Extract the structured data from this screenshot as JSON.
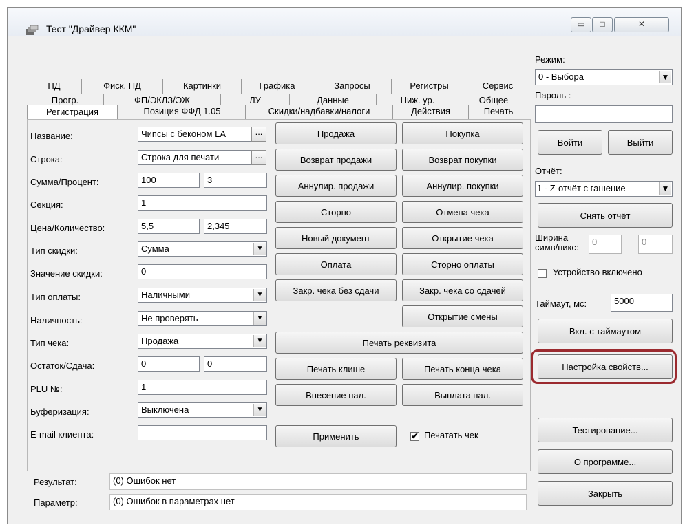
{
  "window": {
    "title": "Тест \"Драйвер ККМ\"",
    "min_label": "▭",
    "max_label": "□",
    "close_label": "✕"
  },
  "tabs": {
    "row1": [
      "ПД",
      "Фиск. ПД",
      "Картинки",
      "Графика",
      "Запросы",
      "Регистры",
      "Сервис"
    ],
    "row2": [
      "Прогр.",
      "ФП/ЭКЛЗ/ЭЖ",
      "ЛУ",
      "Данные",
      "Ниж. ур.",
      "Общее"
    ],
    "row3": [
      "Регистрация",
      "Позиция ФФД 1.05",
      "Скидки/надбавки/налоги",
      "Действия",
      "Печать"
    ],
    "active": "Регистрация"
  },
  "form": {
    "name_label": "Название:",
    "name_value": "Чипсы с беконом LA",
    "string_label": "Строка:",
    "string_value": "Строка для печати",
    "sum_label": "Сумма/Процент:",
    "sum_value": "100",
    "percent_value": "3",
    "section_label": "Секция:",
    "section_value": "1",
    "price_label": "Цена/Количество:",
    "price_value": "5,5",
    "qty_value": "2,345",
    "discount_type_label": "Тип скидки:",
    "discount_type_value": "Сумма",
    "discount_value_label": "Значение скидки:",
    "discount_value": "0",
    "payment_type_label": "Тип оплаты:",
    "payment_type_value": "Наличными",
    "cash_check_label": "Наличность:",
    "cash_check_value": "Не проверять",
    "receipt_type_label": "Тип чека:",
    "receipt_type_value": "Продажа",
    "remain_label": "Остаток/Сдача:",
    "remain_value": "0",
    "change_value": "0",
    "plu_label": "PLU №:",
    "plu_value": "1",
    "buffer_label": "Буферизация:",
    "buffer_value": "Выключена",
    "email_label": "E-mail клиента:",
    "email_value": "",
    "dots": "..."
  },
  "actions": {
    "sale": "Продажа",
    "purchase": "Покупка",
    "return_sale": "Возврат продажи",
    "return_purchase": "Возврат покупки",
    "cancel_sale": "Аннулир. продажи",
    "cancel_purchase": "Аннулир. покупки",
    "storno": "Сторно",
    "cancel_receipt": "Отмена чека",
    "new_document": "Новый документ",
    "open_receipt": "Открытие чека",
    "payment": "Оплата",
    "storno_payment": "Сторно оплаты",
    "close_no_change": "Закр. чека без сдачи",
    "close_with_change": "Закр. чека со сдачей",
    "open_shift": "Открытие смены",
    "print_requisite": "Печать реквизита",
    "print_cliche": "Печать клише",
    "print_end": "Печать конца чека",
    "cash_in": "Внесение нал.",
    "cash_out": "Выплата нал.",
    "apply": "Применить",
    "print_receipt_label": "Печатать чек",
    "print_receipt_checked": "✔"
  },
  "status": {
    "result_label": "Результат:",
    "result_value": "(0) Ошибок нет",
    "param_label": "Параметр:",
    "param_value": "(0) Ошибок в параметрах нет"
  },
  "right": {
    "mode_label": "Режим:",
    "mode_value": "0 - Выбора",
    "password_label": "Пароль :",
    "password_value": "",
    "login": "Войти",
    "logout": "Выйти",
    "report_label": "Отчёт:",
    "report_value": "1 - Z-отчёт с гашение",
    "take_report": "Снять отчёт",
    "width_label_1": "Ширина",
    "width_label_2": "симв/пикс:",
    "width_chars": "0",
    "width_pixels": "0",
    "device_on_label": "Устройство включено",
    "timeout_label": "Таймаут, мс:",
    "timeout_value": "5000",
    "on_with_timeout": "Вкл. с таймаутом",
    "settings": "Настройка свойств...",
    "testing": "Тестирование...",
    "about": "О программе...",
    "close": "Закрыть",
    "arrow": "▼"
  }
}
